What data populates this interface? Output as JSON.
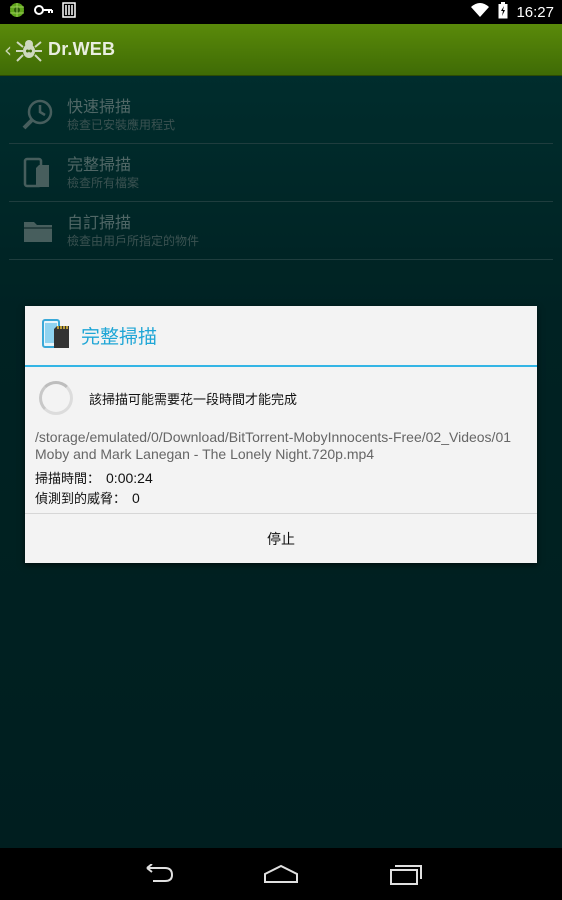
{
  "status_bar": {
    "time": "16:27"
  },
  "app_bar": {
    "brand": "Dr.WEB",
    "back": "‹"
  },
  "menu": {
    "items": [
      {
        "title": "快速掃描",
        "subtitle": "檢查已安裝應用程式",
        "icon": "clock-search-icon"
      },
      {
        "title": "完整掃描",
        "subtitle": "檢查所有檔案",
        "icon": "phone-sdcard-icon"
      },
      {
        "title": "自訂掃描",
        "subtitle": "檢查由用戶所指定的物件",
        "icon": "folder-icon"
      }
    ]
  },
  "dialog": {
    "title": "完整掃描",
    "message": "該掃描可能需要花一段時間才能完成",
    "path": "/storage/emulated/0/Download/BitTorrent-MobyInnocents-Free/02_Videos/01 Moby and Mark Lanegan - The Lonely Night.720p.mp4",
    "scan_time_label": "掃描時間：",
    "scan_time_value": "0:00:24",
    "threats_label": "偵測到的威脅：",
    "threats_value": "0",
    "stop_label": "停止"
  },
  "colors": {
    "accent": "#33b5e5",
    "app_bar": "#4a7a08",
    "background": "#013c3c"
  }
}
